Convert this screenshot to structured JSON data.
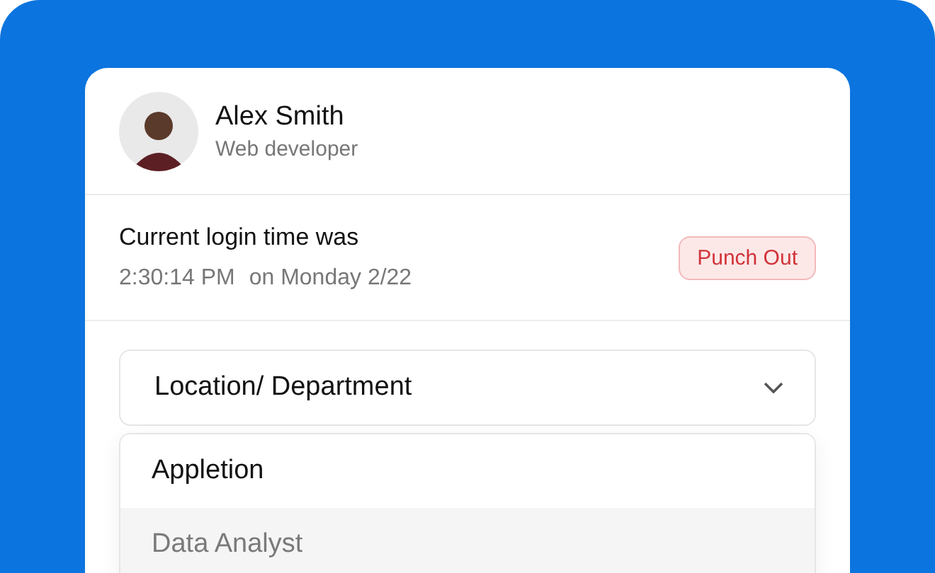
{
  "user": {
    "name": "Alex Smith",
    "role": "Web developer"
  },
  "login": {
    "label": "Current login time was",
    "time": "2:30:14 PM",
    "date": "on Monday 2/22",
    "button": "Punch Out"
  },
  "select": {
    "label": "Location/ Department",
    "expanded": true
  },
  "options": [
    {
      "label": "Appletion",
      "highlighted": false
    },
    {
      "label": "Data Analyst",
      "highlighted": true
    }
  ]
}
